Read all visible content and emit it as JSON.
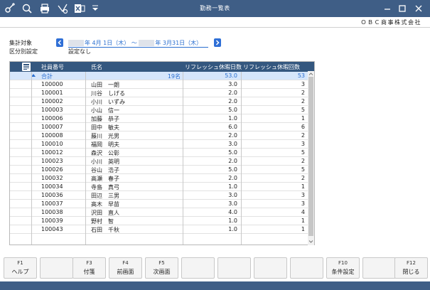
{
  "window": {
    "title": "勤務一覧表",
    "toolbar_icons": [
      "key-add-icon",
      "zoom-icon",
      "print-icon",
      "clear-icon",
      "excel-icon",
      "dropdown-icon"
    ],
    "controls": [
      "minimize-icon",
      "restore-icon",
      "close-icon"
    ]
  },
  "company": "ＯＢＣ商事株式会社",
  "filters": {
    "period_label": "集計対象",
    "period_start": "年 4月 1日（木）",
    "period_sep": "～",
    "period_end": "年 3月31日（木）",
    "division_label": "区分別設定",
    "division_value": "設定なし"
  },
  "table": {
    "headers": {
      "id": "社員番号",
      "name": "氏名",
      "days": "リフレッシュ休暇日数",
      "count": "リフレッシュ休暇回数"
    },
    "total": {
      "label": "合計",
      "people": "19名",
      "days": "53.0",
      "count": "53"
    },
    "rows": [
      {
        "id": "100000",
        "name": "山田　一朗",
        "days": "3.0",
        "count": "3"
      },
      {
        "id": "100001",
        "name": "川谷　しげる",
        "days": "2.0",
        "count": "2"
      },
      {
        "id": "100002",
        "name": "小川　いずみ",
        "days": "2.0",
        "count": "2"
      },
      {
        "id": "100003",
        "name": "小山　信一",
        "days": "5.0",
        "count": "5"
      },
      {
        "id": "100006",
        "name": "加藤　恭子",
        "days": "1.0",
        "count": "1"
      },
      {
        "id": "100007",
        "name": "田中　敏夫",
        "days": "6.0",
        "count": "6"
      },
      {
        "id": "100008",
        "name": "藤川　光男",
        "days": "2.0",
        "count": "2"
      },
      {
        "id": "100010",
        "name": "福岡　明夫",
        "days": "3.0",
        "count": "3"
      },
      {
        "id": "100012",
        "name": "森沢　公彰",
        "days": "5.0",
        "count": "5"
      },
      {
        "id": "100023",
        "name": "小川　英明",
        "days": "2.0",
        "count": "2"
      },
      {
        "id": "100026",
        "name": "谷山　浩子",
        "days": "5.0",
        "count": "5"
      },
      {
        "id": "100032",
        "name": "高瀬　春子",
        "days": "2.0",
        "count": "2"
      },
      {
        "id": "100034",
        "name": "寺島　真弓",
        "days": "1.0",
        "count": "1"
      },
      {
        "id": "100036",
        "name": "田辺　三男",
        "days": "3.0",
        "count": "3"
      },
      {
        "id": "100037",
        "name": "高木　早苗",
        "days": "3.0",
        "count": "3"
      },
      {
        "id": "100038",
        "name": "沢田　直人",
        "days": "4.0",
        "count": "4"
      },
      {
        "id": "100039",
        "name": "野村　智",
        "days": "1.0",
        "count": "1"
      },
      {
        "id": "100043",
        "name": "石田　千秋",
        "days": "1.0",
        "count": "1"
      }
    ]
  },
  "fkeys": [
    {
      "key": "F1",
      "label": "ヘルプ"
    },
    {
      "key": "",
      "label": ""
    },
    {
      "key": "F3",
      "label": "付箋"
    },
    {
      "key": "F4",
      "label": "前画面"
    },
    {
      "key": "F5",
      "label": "次画面"
    },
    {
      "key": "",
      "label": ""
    },
    {
      "key": "",
      "label": ""
    },
    {
      "key": "",
      "label": ""
    },
    {
      "key": "",
      "label": ""
    },
    {
      "key": "F10",
      "label": "条件設定"
    },
    {
      "key": "",
      "label": ""
    },
    {
      "key": "F12",
      "label": "閉じる"
    }
  ]
}
